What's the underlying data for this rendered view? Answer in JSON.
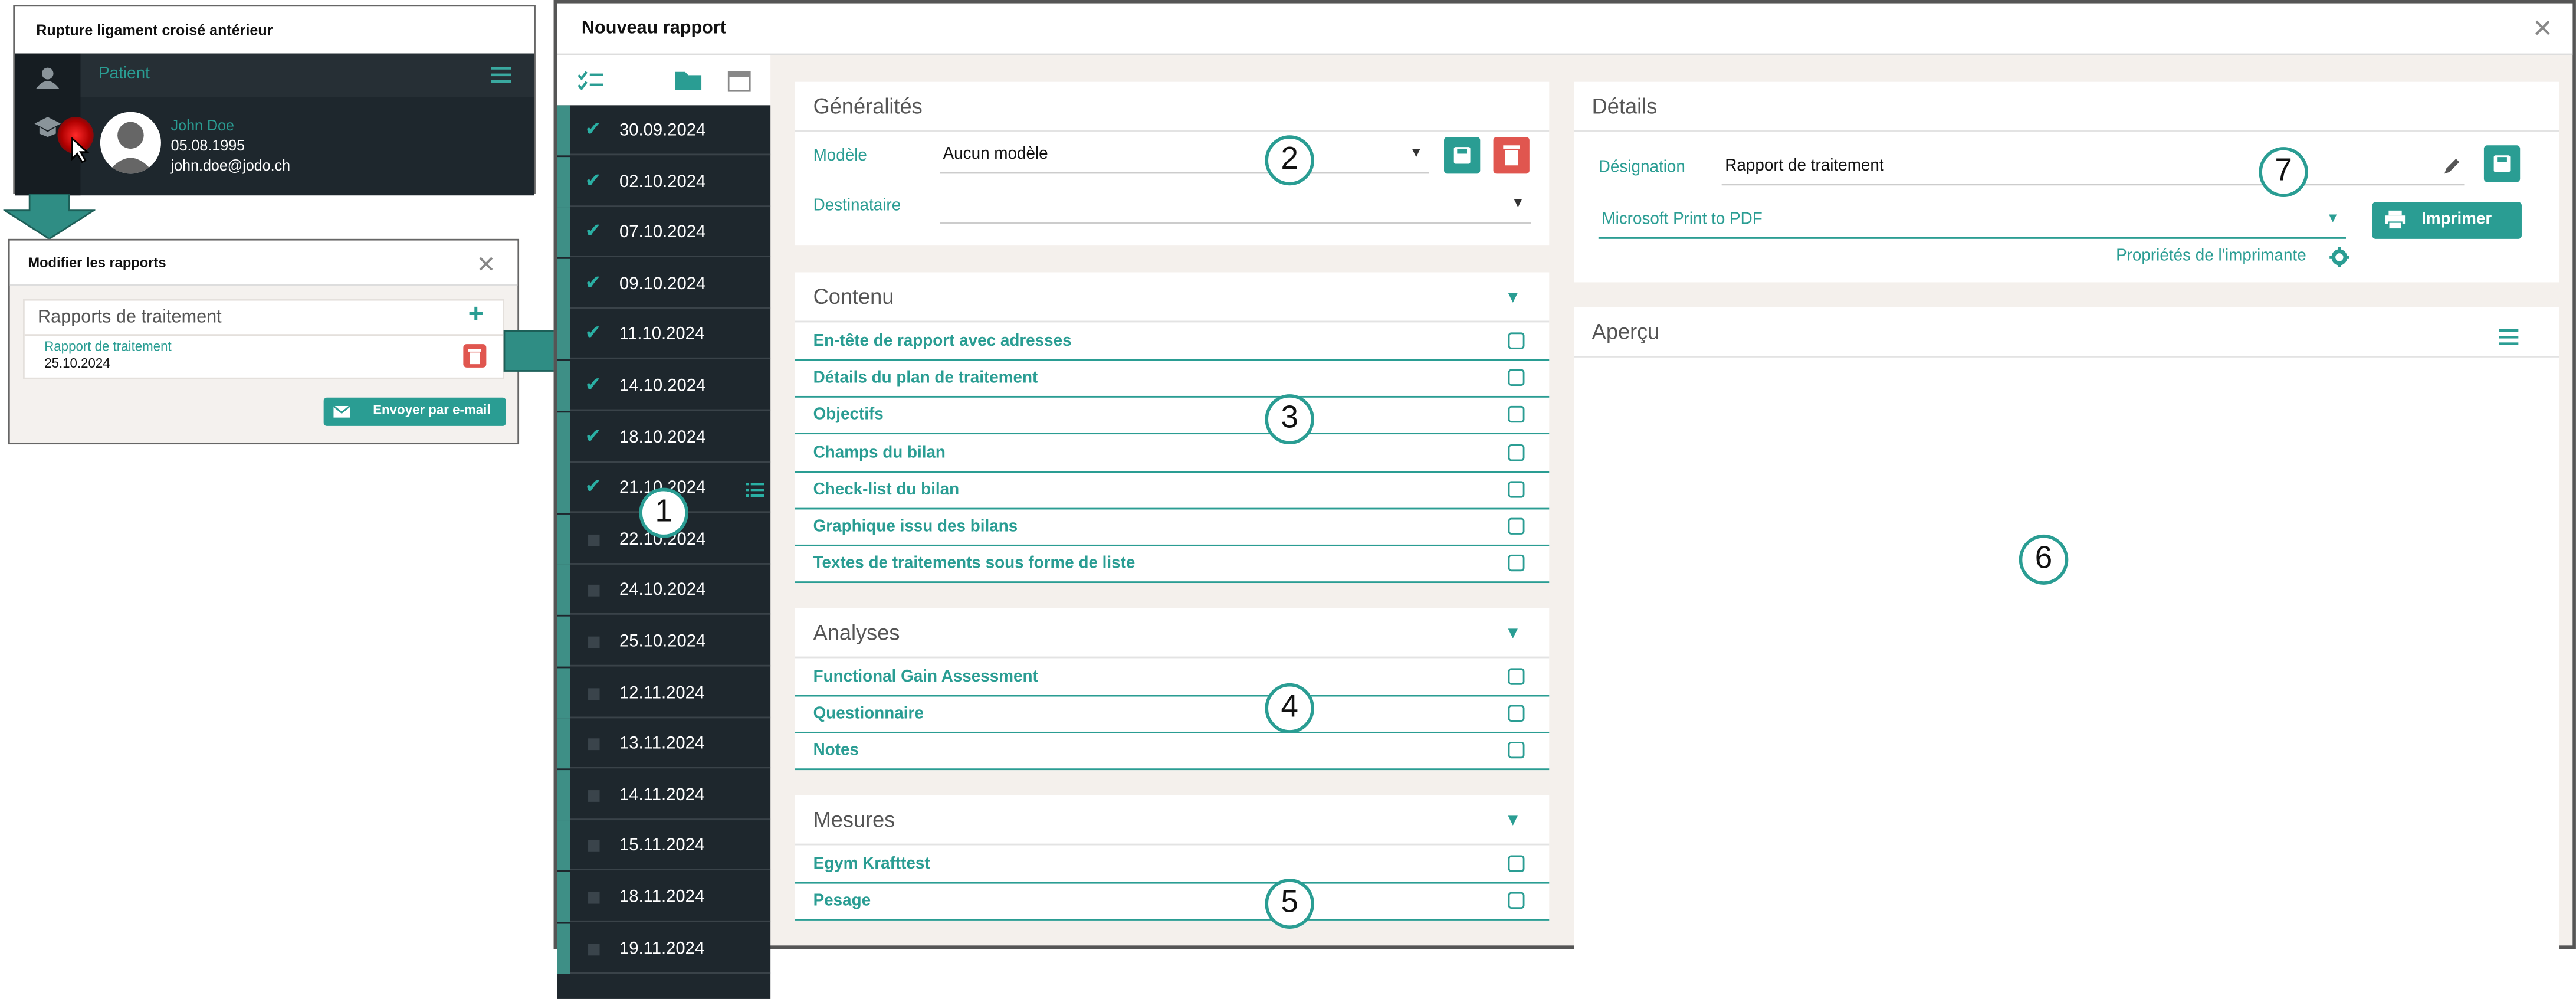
{
  "patient_panel": {
    "title": "Rupture ligament croisé antérieur",
    "header_label": "Patient",
    "name": "John Doe",
    "dob": "05.08.1995",
    "email": "john.doe@jodo.ch"
  },
  "modify_panel": {
    "title": "Modifier les rapports",
    "section_title": "Rapports de traitement",
    "report_name": "Rapport de traitement",
    "report_date": "25.10.2024",
    "email_button": "Envoyer par e-mail"
  },
  "dialog": {
    "title": "Nouveau rapport",
    "close": "✕"
  },
  "dates": [
    {
      "label": "30.09.2024",
      "checked": true
    },
    {
      "label": "02.10.2024",
      "checked": true
    },
    {
      "label": "07.10.2024",
      "checked": true
    },
    {
      "label": "09.10.2024",
      "checked": true
    },
    {
      "label": "11.10.2024",
      "checked": true
    },
    {
      "label": "14.10.2024",
      "checked": true
    },
    {
      "label": "18.10.2024",
      "checked": true
    },
    {
      "label": "21.10.2024",
      "checked": true
    },
    {
      "label": "22.10.2024",
      "checked": false
    },
    {
      "label": "24.10.2024",
      "checked": false
    },
    {
      "label": "25.10.2024",
      "checked": false
    },
    {
      "label": "12.11.2024",
      "checked": false
    },
    {
      "label": "13.11.2024",
      "checked": false
    },
    {
      "label": "14.11.2024",
      "checked": false
    },
    {
      "label": "15.11.2024",
      "checked": false
    },
    {
      "label": "18.11.2024",
      "checked": false
    },
    {
      "label": "19.11.2024",
      "checked": false
    }
  ],
  "generalites": {
    "title": "Généralités",
    "modele_label": "Modèle",
    "modele_value": "Aucun modèle",
    "destinataire_label": "Destinataire",
    "destinataire_value": ""
  },
  "contenu": {
    "title": "Contenu",
    "items": [
      "En-tête de rapport avec adresses",
      "Détails du plan de traitement",
      "Objectifs",
      "Champs du bilan",
      "Check-list du bilan",
      "Graphique issu des bilans",
      "Textes de traitements sous forme de liste"
    ]
  },
  "analyses": {
    "title": "Analyses",
    "items": [
      "Functional Gain Assessment",
      "Questionnaire",
      "Notes"
    ]
  },
  "mesures": {
    "title": "Mesures",
    "items": [
      "Egym Krafttest",
      "Pesage"
    ]
  },
  "details": {
    "title": "Détails",
    "designation_label": "Désignation",
    "designation_value": "Rapport de traitement",
    "printer_value": "Microsoft Print to PDF",
    "print_button": "Imprimer",
    "printer_props": "Propriétés de l'imprimante"
  },
  "apercu": {
    "title": "Aperçu"
  },
  "callouts": [
    "1",
    "2",
    "3",
    "4",
    "5",
    "6",
    "7"
  ],
  "colors": {
    "accent": "#2a9d93",
    "danger": "#e0564f",
    "dark": "#1e272d"
  },
  "icons": [
    "user-icon",
    "menu-icon",
    "avatar-icon",
    "plus-icon",
    "trash-icon",
    "envelope-icon",
    "checklist-icon",
    "folder-icon",
    "calendar-icon",
    "list-icon",
    "save-icon",
    "pencil-icon",
    "printer-icon",
    "gear-icon",
    "close-icon",
    "arrow-down-icon",
    "arrow-right-icon"
  ]
}
